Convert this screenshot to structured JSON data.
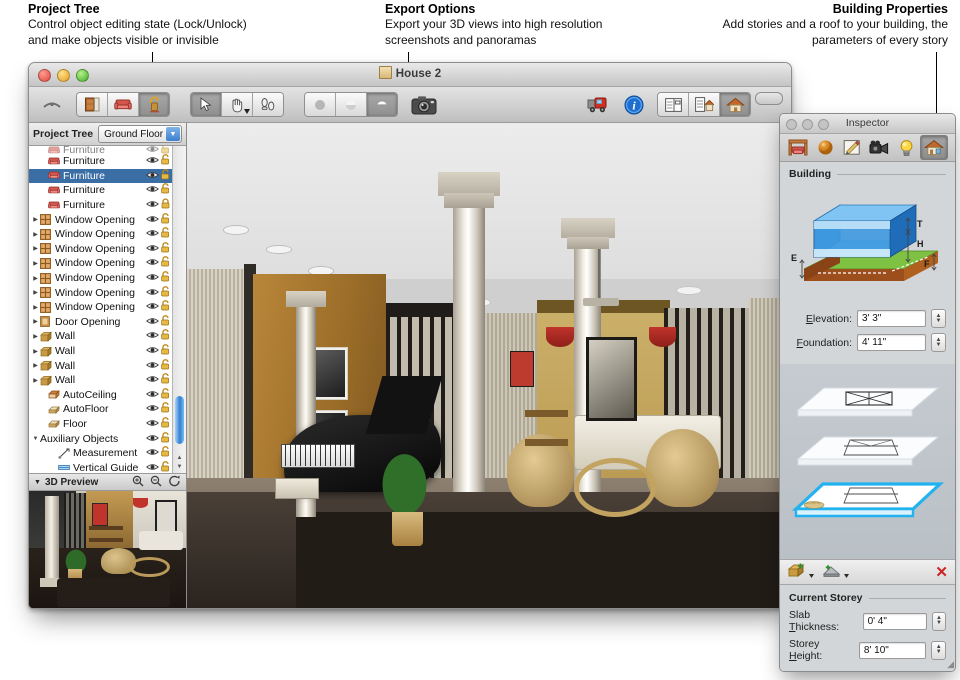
{
  "callouts": [
    {
      "id": "project-tree",
      "title": "Project Tree",
      "lines": [
        "Control object editing state (Lock/Unlock)",
        "and make objects visible or invisible"
      ]
    },
    {
      "id": "export-options",
      "title": "Export Options",
      "lines": [
        "Export your 3D views into high resolution",
        "screenshots and panoramas"
      ]
    },
    {
      "id": "building-properties",
      "title": "Building Properties",
      "lines": [
        "Add stories and a roof to your building, the",
        "parameters of every story"
      ]
    }
  ],
  "window": {
    "title": "House 2",
    "traffic_lights": [
      "close-button",
      "minimize-button",
      "zoom-button"
    ],
    "toolbar": {
      "groups": [
        {
          "name": "object-mode-group",
          "buttons": [
            {
              "name": "tb-furniture-library",
              "icon": "wardrobe-icon",
              "state": "off"
            },
            {
              "name": "tb-furniture-object",
              "icon": "armchair-icon",
              "state": "off"
            },
            {
              "name": "tb-lock-unlock",
              "icon": "lock-unlock-icon",
              "state": "on"
            }
          ]
        },
        {
          "name": "navigation-group",
          "buttons": [
            {
              "name": "tb-select-tool",
              "icon": "arrow-cursor-icon",
              "state": "on"
            },
            {
              "name": "tb-pan-tool",
              "icon": "hand-icon",
              "state": "off"
            },
            {
              "name": "tb-walk-tool",
              "icon": "footsteps-icon",
              "state": "off"
            }
          ]
        },
        {
          "name": "render-quality-group",
          "buttons": [
            {
              "name": "tb-flat-shading",
              "icon": "flat-sphere-icon",
              "state": "off"
            },
            {
              "name": "tb-smooth-shading",
              "icon": "shaded-sphere-icon",
              "state": "off"
            },
            {
              "name": "tb-realistic-shading",
              "icon": "glossy-sphere-icon",
              "state": "on"
            }
          ]
        }
      ],
      "camera_button": {
        "name": "tb-export-screenshot",
        "icon": "camera-icon"
      },
      "right_buttons": [
        {
          "name": "tb-transport",
          "icon": "red-truck-icon"
        },
        {
          "name": "tb-info",
          "icon": "info-circle-icon"
        },
        {
          "name": "tb-layout-2d",
          "icon": "layout-2d-icon",
          "state": "off"
        },
        {
          "name": "tb-layout-split",
          "icon": "layout-split-house-icon",
          "state": "off"
        },
        {
          "name": "tb-layout-3d",
          "icon": "house-icon",
          "state": "on"
        }
      ]
    }
  },
  "project_tree": {
    "header_label": "Project Tree",
    "floor_selector": {
      "value": "Ground Floor",
      "name": "floor-dropdown"
    },
    "columns": [
      "name",
      "visible",
      "locked"
    ],
    "items": [
      {
        "label": "Furniture",
        "icon": "furniture-icon",
        "indent": 1,
        "disclosure": "",
        "visible": true,
        "locked": false,
        "selected": false,
        "clipped": true
      },
      {
        "label": "Furniture",
        "icon": "furniture-icon",
        "indent": 1,
        "disclosure": "",
        "visible": true,
        "locked": false,
        "selected": false
      },
      {
        "label": "Furniture",
        "icon": "furniture-icon",
        "indent": 1,
        "disclosure": "",
        "visible": true,
        "locked": false,
        "selected": true
      },
      {
        "label": "Furniture",
        "icon": "furniture-icon",
        "indent": 1,
        "disclosure": "",
        "visible": true,
        "locked": false,
        "selected": false
      },
      {
        "label": "Furniture",
        "icon": "furniture-icon",
        "indent": 1,
        "disclosure": "",
        "visible": true,
        "locked": true,
        "selected": false
      },
      {
        "label": "Window Opening",
        "icon": "window-icon",
        "indent": 0,
        "disclosure": "collapsed",
        "visible": true,
        "locked": false,
        "selected": false
      },
      {
        "label": "Window Opening",
        "icon": "window-icon",
        "indent": 0,
        "disclosure": "collapsed",
        "visible": true,
        "locked": false,
        "selected": false
      },
      {
        "label": "Window Opening",
        "icon": "window-icon",
        "indent": 0,
        "disclosure": "collapsed",
        "visible": true,
        "locked": false,
        "selected": false
      },
      {
        "label": "Window Opening",
        "icon": "window-icon",
        "indent": 0,
        "disclosure": "collapsed",
        "visible": true,
        "locked": false,
        "selected": false
      },
      {
        "label": "Window Opening",
        "icon": "window-icon",
        "indent": 0,
        "disclosure": "collapsed",
        "visible": true,
        "locked": false,
        "selected": false
      },
      {
        "label": "Window Opening",
        "icon": "window-icon",
        "indent": 0,
        "disclosure": "collapsed",
        "visible": true,
        "locked": false,
        "selected": false
      },
      {
        "label": "Window Opening",
        "icon": "window-icon",
        "indent": 0,
        "disclosure": "collapsed",
        "visible": true,
        "locked": false,
        "selected": false
      },
      {
        "label": "Door Opening",
        "icon": "door-icon",
        "indent": 0,
        "disclosure": "collapsed",
        "visible": true,
        "locked": false,
        "selected": false
      },
      {
        "label": "Wall",
        "icon": "wall-icon",
        "indent": 0,
        "disclosure": "collapsed",
        "visible": true,
        "locked": false,
        "selected": false
      },
      {
        "label": "Wall",
        "icon": "wall-icon",
        "indent": 0,
        "disclosure": "collapsed",
        "visible": true,
        "locked": false,
        "selected": false
      },
      {
        "label": "Wall",
        "icon": "wall-icon",
        "indent": 0,
        "disclosure": "collapsed",
        "visible": true,
        "locked": false,
        "selected": false
      },
      {
        "label": "Wall",
        "icon": "wall-icon",
        "indent": 0,
        "disclosure": "collapsed",
        "visible": true,
        "locked": false,
        "selected": false
      },
      {
        "label": "AutoCeiling",
        "icon": "ceiling-icon",
        "indent": 1,
        "disclosure": "",
        "visible": true,
        "locked": false,
        "selected": false
      },
      {
        "label": "AutoFloor",
        "icon": "floor-icon",
        "indent": 1,
        "disclosure": "",
        "visible": true,
        "locked": false,
        "selected": false
      },
      {
        "label": "Floor",
        "icon": "floor-icon",
        "indent": 1,
        "disclosure": "",
        "visible": true,
        "locked": false,
        "selected": false
      },
      {
        "label": "Auxiliary Objects",
        "icon": "",
        "indent": 0,
        "disclosure": "expanded",
        "visible": true,
        "locked": false,
        "selected": false
      },
      {
        "label": "Measurement",
        "icon": "measurement-icon",
        "indent": 2,
        "disclosure": "",
        "visible": true,
        "locked": false,
        "selected": false
      },
      {
        "label": "Vertical Guide",
        "icon": "guide-icon",
        "indent": 2,
        "disclosure": "",
        "visible": true,
        "locked": false,
        "selected": false
      }
    ]
  },
  "preview_panel": {
    "title": "3D Preview",
    "buttons": [
      {
        "name": "preview-zoom-in",
        "icon": "zoom-in-icon"
      },
      {
        "name": "preview-zoom-out",
        "icon": "zoom-out-icon"
      },
      {
        "name": "preview-rotate",
        "icon": "rotate-icon"
      }
    ]
  },
  "inspector": {
    "title": "Inspector",
    "tabs": [
      {
        "name": "tab-object",
        "icon": "furniture-object-icon",
        "active": false
      },
      {
        "name": "tab-material",
        "icon": "material-sphere-icon",
        "active": false
      },
      {
        "name": "tab-edit",
        "icon": "pencil-ruler-icon",
        "active": false
      },
      {
        "name": "tab-camera",
        "icon": "camera-icon",
        "active": false
      },
      {
        "name": "tab-light",
        "icon": "light-bulb-icon",
        "active": false
      },
      {
        "name": "tab-building",
        "icon": "building-house-icon",
        "active": true
      }
    ],
    "building": {
      "section_title": "Building",
      "diagram_labels": {
        "top": "T",
        "height": "H",
        "elevation": "E",
        "foundation": "F"
      },
      "fields": [
        {
          "name": "elevation-field",
          "label": "Elevation:",
          "mnemonic": "E",
          "value": "3' 3\""
        },
        {
          "name": "foundation-field",
          "label": "Foundation:",
          "mnemonic": "F",
          "value": "4' 11\""
        }
      ]
    },
    "storeys": {
      "items": [
        {
          "name": "storey-roof",
          "selected": false,
          "type": "roof"
        },
        {
          "name": "storey-upper",
          "selected": false,
          "type": "storey"
        },
        {
          "name": "storey-ground",
          "selected": true,
          "type": "storey"
        }
      ],
      "controls": [
        {
          "name": "add-storey-button",
          "icon": "add-storey-icon"
        },
        {
          "name": "add-roof-button",
          "icon": "add-roof-icon"
        },
        {
          "name": "delete-storey-button",
          "icon": "close-x-icon"
        }
      ]
    },
    "current_storey": {
      "section_title": "Current Storey",
      "fields": [
        {
          "name": "slab-thickness-field",
          "label": "Slab Thickness:",
          "mnemonic": "T",
          "value": "0' 4\""
        },
        {
          "name": "storey-height-field",
          "label": "Storey Height:",
          "mnemonic": "H",
          "value": "8' 10\""
        }
      ]
    }
  },
  "colors": {
    "selection_blue": "#3a6ea5",
    "storey_highlight": "#22b2f0",
    "delete_red": "#cf2222",
    "lock_gold": "#d9a326",
    "window_chrome": "#d4d4d4"
  }
}
